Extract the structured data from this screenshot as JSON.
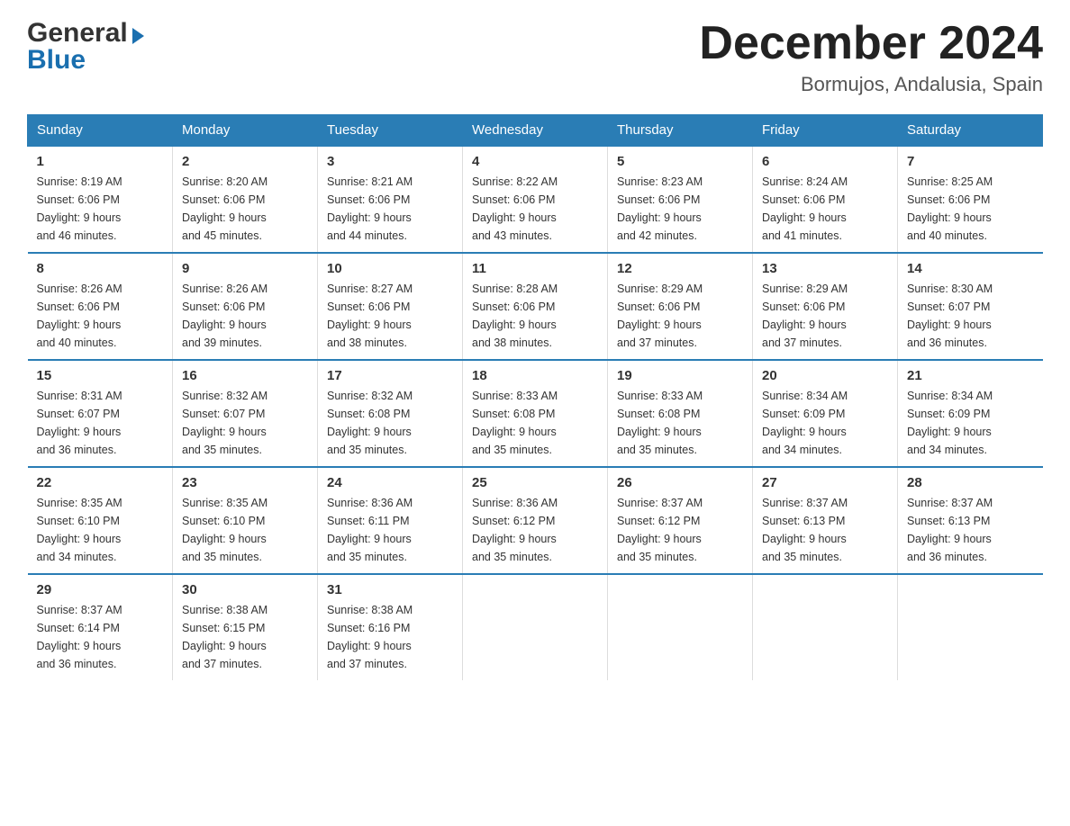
{
  "header": {
    "month_title": "December 2024",
    "location": "Bormujos, Andalusia, Spain",
    "logo_general": "General",
    "logo_blue": "Blue"
  },
  "days_of_week": [
    "Sunday",
    "Monday",
    "Tuesday",
    "Wednesday",
    "Thursday",
    "Friday",
    "Saturday"
  ],
  "weeks": [
    [
      {
        "num": "1",
        "sunrise": "8:19 AM",
        "sunset": "6:06 PM",
        "daylight": "9 hours and 46 minutes."
      },
      {
        "num": "2",
        "sunrise": "8:20 AM",
        "sunset": "6:06 PM",
        "daylight": "9 hours and 45 minutes."
      },
      {
        "num": "3",
        "sunrise": "8:21 AM",
        "sunset": "6:06 PM",
        "daylight": "9 hours and 44 minutes."
      },
      {
        "num": "4",
        "sunrise": "8:22 AM",
        "sunset": "6:06 PM",
        "daylight": "9 hours and 43 minutes."
      },
      {
        "num": "5",
        "sunrise": "8:23 AM",
        "sunset": "6:06 PM",
        "daylight": "9 hours and 42 minutes."
      },
      {
        "num": "6",
        "sunrise": "8:24 AM",
        "sunset": "6:06 PM",
        "daylight": "9 hours and 41 minutes."
      },
      {
        "num": "7",
        "sunrise": "8:25 AM",
        "sunset": "6:06 PM",
        "daylight": "9 hours and 40 minutes."
      }
    ],
    [
      {
        "num": "8",
        "sunrise": "8:26 AM",
        "sunset": "6:06 PM",
        "daylight": "9 hours and 40 minutes."
      },
      {
        "num": "9",
        "sunrise": "8:26 AM",
        "sunset": "6:06 PM",
        "daylight": "9 hours and 39 minutes."
      },
      {
        "num": "10",
        "sunrise": "8:27 AM",
        "sunset": "6:06 PM",
        "daylight": "9 hours and 38 minutes."
      },
      {
        "num": "11",
        "sunrise": "8:28 AM",
        "sunset": "6:06 PM",
        "daylight": "9 hours and 38 minutes."
      },
      {
        "num": "12",
        "sunrise": "8:29 AM",
        "sunset": "6:06 PM",
        "daylight": "9 hours and 37 minutes."
      },
      {
        "num": "13",
        "sunrise": "8:29 AM",
        "sunset": "6:06 PM",
        "daylight": "9 hours and 37 minutes."
      },
      {
        "num": "14",
        "sunrise": "8:30 AM",
        "sunset": "6:07 PM",
        "daylight": "9 hours and 36 minutes."
      }
    ],
    [
      {
        "num": "15",
        "sunrise": "8:31 AM",
        "sunset": "6:07 PM",
        "daylight": "9 hours and 36 minutes."
      },
      {
        "num": "16",
        "sunrise": "8:32 AM",
        "sunset": "6:07 PM",
        "daylight": "9 hours and 35 minutes."
      },
      {
        "num": "17",
        "sunrise": "8:32 AM",
        "sunset": "6:08 PM",
        "daylight": "9 hours and 35 minutes."
      },
      {
        "num": "18",
        "sunrise": "8:33 AM",
        "sunset": "6:08 PM",
        "daylight": "9 hours and 35 minutes."
      },
      {
        "num": "19",
        "sunrise": "8:33 AM",
        "sunset": "6:08 PM",
        "daylight": "9 hours and 35 minutes."
      },
      {
        "num": "20",
        "sunrise": "8:34 AM",
        "sunset": "6:09 PM",
        "daylight": "9 hours and 34 minutes."
      },
      {
        "num": "21",
        "sunrise": "8:34 AM",
        "sunset": "6:09 PM",
        "daylight": "9 hours and 34 minutes."
      }
    ],
    [
      {
        "num": "22",
        "sunrise": "8:35 AM",
        "sunset": "6:10 PM",
        "daylight": "9 hours and 34 minutes."
      },
      {
        "num": "23",
        "sunrise": "8:35 AM",
        "sunset": "6:10 PM",
        "daylight": "9 hours and 35 minutes."
      },
      {
        "num": "24",
        "sunrise": "8:36 AM",
        "sunset": "6:11 PM",
        "daylight": "9 hours and 35 minutes."
      },
      {
        "num": "25",
        "sunrise": "8:36 AM",
        "sunset": "6:12 PM",
        "daylight": "9 hours and 35 minutes."
      },
      {
        "num": "26",
        "sunrise": "8:37 AM",
        "sunset": "6:12 PM",
        "daylight": "9 hours and 35 minutes."
      },
      {
        "num": "27",
        "sunrise": "8:37 AM",
        "sunset": "6:13 PM",
        "daylight": "9 hours and 35 minutes."
      },
      {
        "num": "28",
        "sunrise": "8:37 AM",
        "sunset": "6:13 PM",
        "daylight": "9 hours and 36 minutes."
      }
    ],
    [
      {
        "num": "29",
        "sunrise": "8:37 AM",
        "sunset": "6:14 PM",
        "daylight": "9 hours and 36 minutes."
      },
      {
        "num": "30",
        "sunrise": "8:38 AM",
        "sunset": "6:15 PM",
        "daylight": "9 hours and 37 minutes."
      },
      {
        "num": "31",
        "sunrise": "8:38 AM",
        "sunset": "6:16 PM",
        "daylight": "9 hours and 37 minutes."
      },
      null,
      null,
      null,
      null
    ]
  ],
  "labels": {
    "sunrise": "Sunrise:",
    "sunset": "Sunset:",
    "daylight": "Daylight:"
  }
}
